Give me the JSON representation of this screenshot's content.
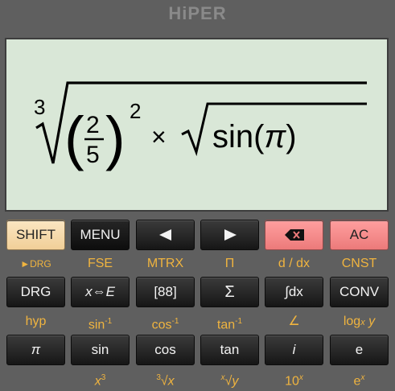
{
  "app_title": "HiPER",
  "display": {
    "root_index": "3",
    "frac_num": "2",
    "frac_den": "5",
    "power": "2",
    "times": "×",
    "sin_text": "sin(",
    "pi": "π",
    "close_paren": ")",
    "open_big": "(",
    "close_big": ")"
  },
  "row1": {
    "shift": "SHIFT",
    "menu": "MENU",
    "ac": "AC"
  },
  "row1_sub": {
    "drg": "►DRG",
    "fse": "FSE",
    "mtrx": "MTRX",
    "pi_prod": "Π",
    "ddx": "d / dx",
    "cnst": "CNST"
  },
  "row2": {
    "drg": "DRG",
    "xe": "x⇔E",
    "matrix": "[88]",
    "sigma": "Σ",
    "integral": "∫dx",
    "conv": "CONV"
  },
  "row2_sub": {
    "hyp": "hyp",
    "asin_base": "sin",
    "asin_exp": "-1",
    "acos_base": "cos",
    "acos_exp": "-1",
    "atan_base": "tan",
    "atan_exp": "-1",
    "angle": "∠",
    "log_base": "log",
    "log_sub": "x",
    "log_y": " y"
  },
  "row3": {
    "pi": "π",
    "sin": "sin",
    "cos": "cos",
    "tan": "tan",
    "i": "i",
    "e": "e"
  },
  "row3_sub": {
    "x3_base": "x",
    "x3_exp": "3",
    "cbrt_idx": "3",
    "cbrt_body": "√x",
    "xrt_idx": "x",
    "xrt_body": "√y",
    "pow10_base": "10",
    "pow10_exp": "x",
    "exp_base": "e",
    "exp_exp": "x"
  }
}
